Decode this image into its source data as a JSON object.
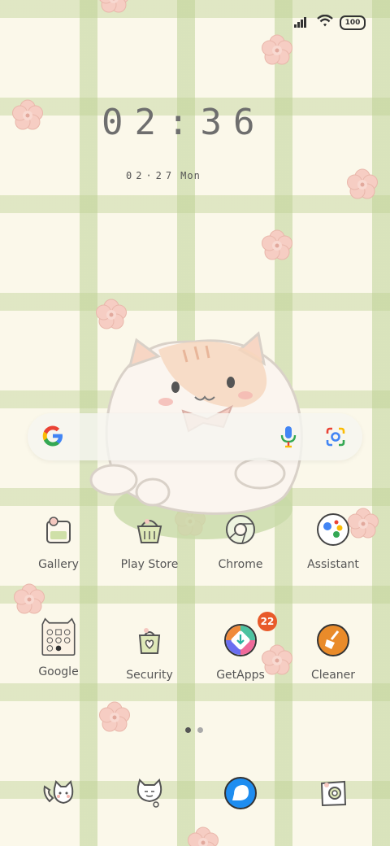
{
  "status_bar": {
    "battery": "100",
    "icons": [
      "signal-icon",
      "wifi-icon",
      "battery-icon"
    ]
  },
  "clock": {
    "time": "02:36",
    "date": "02·27",
    "day": "Mon"
  },
  "search_bar": {
    "icons": [
      "google-g-icon",
      "mic-icon",
      "google-lens-icon"
    ]
  },
  "apps_row1": [
    {
      "label": "Gallery",
      "icon": "gallery-icon"
    },
    {
      "label": "Play Store",
      "icon": "play-store-icon"
    },
    {
      "label": "Chrome",
      "icon": "chrome-icon"
    },
    {
      "label": "Assistant",
      "icon": "assistant-icon"
    }
  ],
  "apps_row2": [
    {
      "label": "Google",
      "icon": "google-folder-icon"
    },
    {
      "label": "Security",
      "icon": "security-icon"
    },
    {
      "label": "GetApps",
      "icon": "getapps-icon",
      "badge": "22"
    },
    {
      "label": "Cleaner",
      "icon": "cleaner-icon"
    }
  ],
  "page_indicator": {
    "pages": 2,
    "current": 1
  },
  "dock": [
    {
      "icon": "phone-icon"
    },
    {
      "icon": "messages-icon"
    },
    {
      "icon": "browser-icon"
    },
    {
      "icon": "camera-icon"
    }
  ],
  "colors": {
    "badge": "#e85a2a",
    "accent_green": "#bcd29a",
    "flower_pink": "#f5c8c0"
  }
}
